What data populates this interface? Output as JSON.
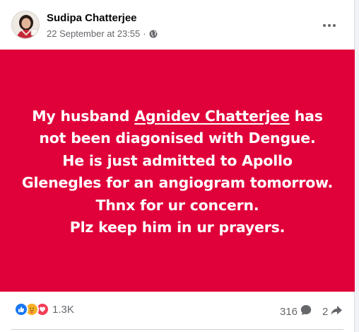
{
  "post": {
    "author_name": "Sudipa Chatterjee",
    "timestamp": "22 September at 23:55",
    "separator": "·",
    "privacy_icon": "globe-icon",
    "more_icon": "more-horizontal-icon",
    "background_color": "#e0003a",
    "text_lines": {
      "line1_before": "My husband ",
      "line1_mention": "Agnidev Chatterjee",
      "line1_after": " has",
      "line2": "not been diagonised with Dengue.",
      "line3": "He is just admitted to Apollo",
      "line4": "Glenegles for an angiogram tomorrow.",
      "line5": "Thnx for ur concern.",
      "line6": "Plz keep him in ur prayers."
    }
  },
  "footer": {
    "reaction_icons": [
      "like-icon",
      "care-icon",
      "love-icon"
    ],
    "reaction_count": "1.3K",
    "comment_count": "316",
    "comment_icon": "comment-bubble-icon",
    "share_count": "2",
    "share_icon": "share-arrow-icon"
  },
  "colors": {
    "post_background": "#e0003a",
    "like": "#1877f2",
    "care": "#f7b125",
    "love": "#f33e58",
    "secondary_text": "#65676b"
  }
}
